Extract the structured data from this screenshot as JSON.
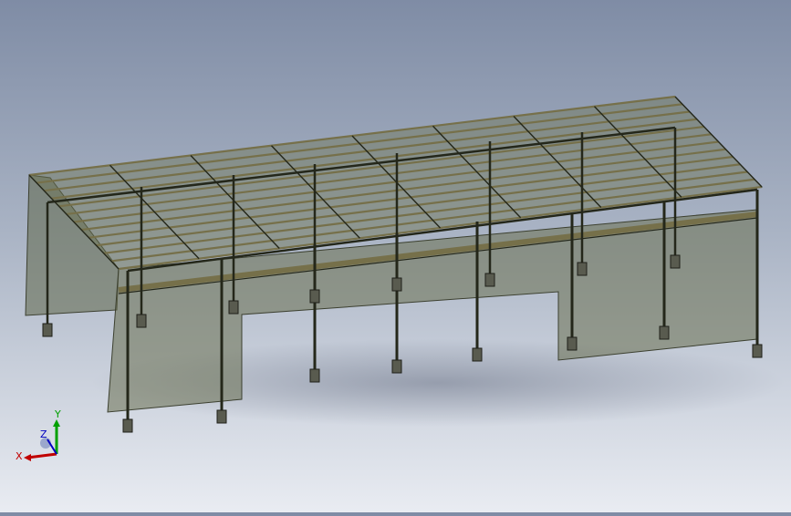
{
  "viewport": {
    "background_top": "#7f8ca5",
    "background_bottom": "#e9ecf2"
  },
  "model": {
    "panel_color": "#5e6648",
    "steel_color": "#24271a",
    "purlin_color": "#76704a",
    "footing_color": "#595b4f",
    "bay_count": 8
  },
  "triad": {
    "x_label": "X",
    "y_label": "Y",
    "z_label": "Z",
    "x_color": "#c00000",
    "y_color": "#00a000",
    "z_color": "#0000c0"
  }
}
